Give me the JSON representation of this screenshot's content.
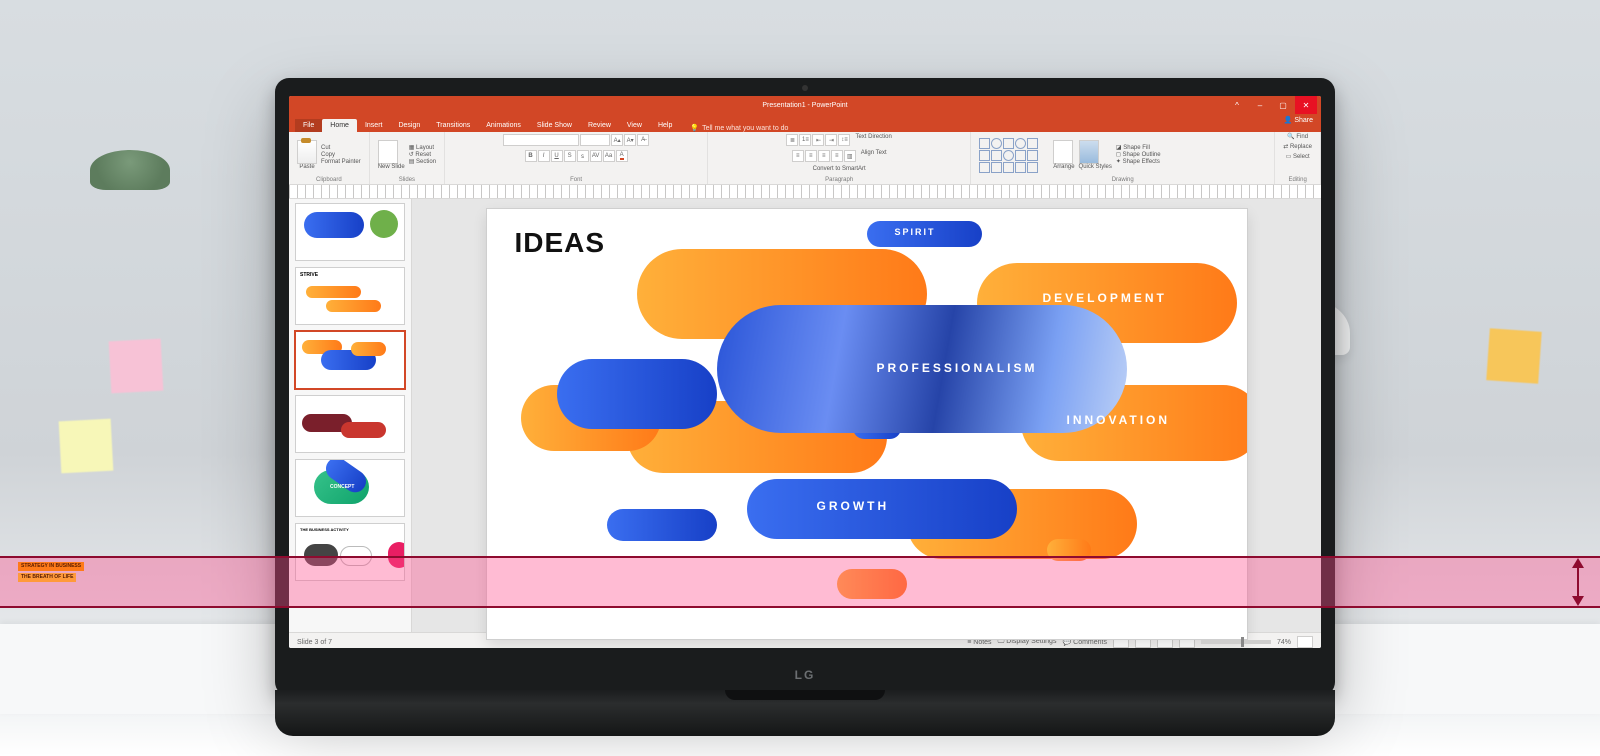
{
  "app": {
    "title": "Presentation1 - PowerPoint",
    "logo": "LG"
  },
  "window_controls": {
    "min": "–",
    "max": "▢",
    "close": "✕",
    "ribbon_toggle": "^"
  },
  "tabs": {
    "file": "File",
    "home": "Home",
    "insert": "Insert",
    "design": "Design",
    "transitions": "Transitions",
    "animations": "Animations",
    "slideshow": "Slide Show",
    "review": "Review",
    "view": "View",
    "help": "Help",
    "tell_me": "Tell me what you want to do",
    "share": "Share"
  },
  "ribbon": {
    "clipboard": {
      "paste": "Paste",
      "cut": "Cut",
      "copy": "Copy",
      "format_painter": "Format Painter",
      "group": "Clipboard"
    },
    "slides": {
      "new_slide": "New Slide",
      "layout": "Layout",
      "reset": "Reset",
      "section": "Section",
      "group": "Slides"
    },
    "font": {
      "group": "Font"
    },
    "paragraph": {
      "text_direction": "Text Direction",
      "align_text": "Align Text",
      "smartart": "Convert to SmartArt",
      "group": "Paragraph"
    },
    "drawing": {
      "arrange": "Arrange",
      "quick_styles": "Quick Styles",
      "shape_fill": "Shape Fill",
      "shape_outline": "Shape Outline",
      "shape_effects": "Shape Effects",
      "group": "Drawing"
    },
    "editing": {
      "find": "Find",
      "replace": "Replace",
      "select": "Select",
      "group": "Editing"
    }
  },
  "slide": {
    "heading": "IDEAS",
    "labels": {
      "spirit": "SPIRIT",
      "development": "DEVELOPMENT",
      "professionalism": "PROFESSIONALISM",
      "innovation": "INNOVATION",
      "growth": "GROWTH"
    }
  },
  "thumbs": {
    "t2": "STRIVE",
    "t5": "CONCEPT",
    "t6": "THE BUSINESS ACTIVITY",
    "t7a": "STRATEGY IN BUSINESS",
    "t7b": "THE BREATH OF LIFE"
  },
  "status": {
    "left": "Slide 3 of 7",
    "notes": "Notes",
    "display": "Display Settings",
    "comments": "Comments",
    "zoom": "74%"
  }
}
